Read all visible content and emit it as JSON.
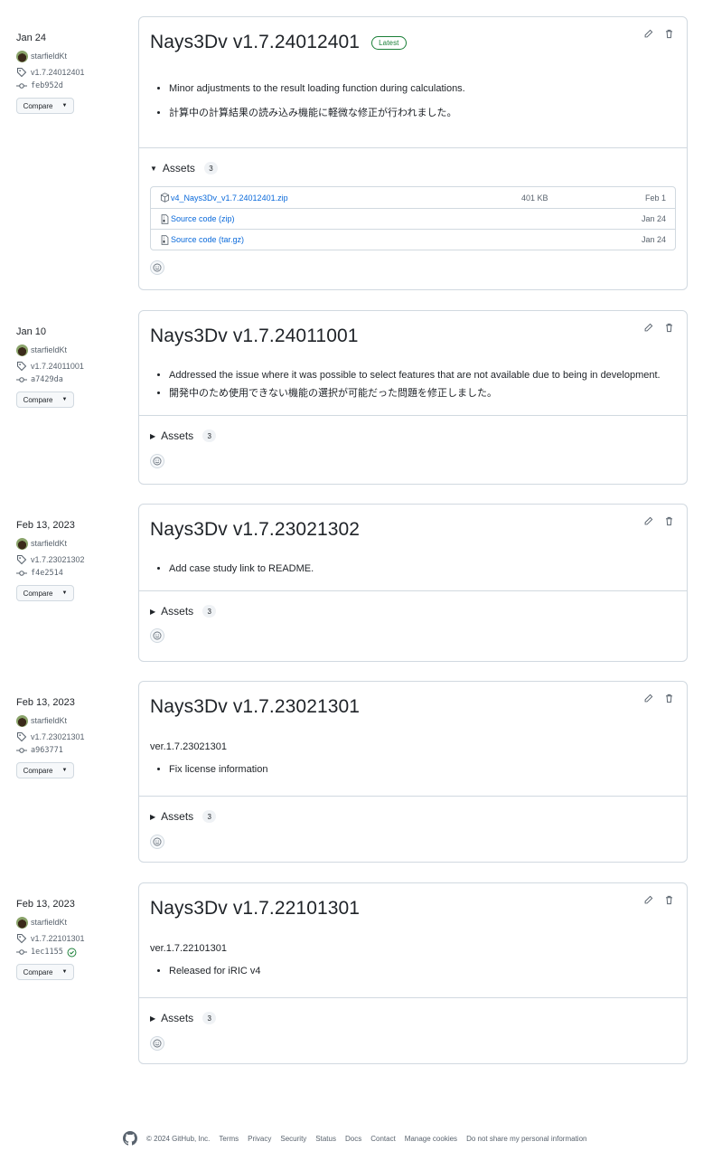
{
  "releases": [
    {
      "date": "Jan 24",
      "author": "starfieldKt",
      "tag": "v1.7.24012401",
      "commit": "feb952d",
      "compare_label": "Compare",
      "title": "Nays3Dv v1.7.24012401",
      "badge": "Latest",
      "notes": [
        "Minor adjustments to the result loading function during calculations.",
        "計算中の計算結果の読み込み機能に軽微な修正が行われました。"
      ],
      "assets_label": "Assets",
      "assets_count": "3",
      "assets_expanded": true,
      "assets": [
        {
          "name": "v4_Nays3Dv_v1.7.24012401.zip",
          "size": "401 KB",
          "date": "Feb 1",
          "icon": "package-icon"
        },
        {
          "name": "Source code (zip)",
          "size": "",
          "date": "Jan 24",
          "icon": "file-zip-icon"
        },
        {
          "name": "Source code (tar.gz)",
          "size": "",
          "date": "Jan 24",
          "icon": "file-zip-icon"
        }
      ]
    },
    {
      "date": "Jan 10",
      "author": "starfieldKt",
      "tag": "v1.7.24011001",
      "commit": "a7429da",
      "compare_label": "Compare",
      "title": "Nays3Dv v1.7.24011001",
      "notes": [
        "Addressed the issue where it was possible to select features that are not available due to being in development.",
        "開発中のため使用できない機能の選択が可能だった問題を修正しました。"
      ],
      "assets_label": "Assets",
      "assets_count": "3"
    },
    {
      "date": "Feb 13, 2023",
      "author": "starfieldKt",
      "tag": "v1.7.23021302",
      "commit": "f4e2514",
      "compare_label": "Compare",
      "title": "Nays3Dv v1.7.23021302",
      "notes": [
        "Add case study link to README."
      ],
      "assets_label": "Assets",
      "assets_count": "3"
    },
    {
      "date": "Feb 13, 2023",
      "author": "starfieldKt",
      "tag": "v1.7.23021301",
      "commit": "a963771",
      "compare_label": "Compare",
      "title": "Nays3Dv v1.7.23021301",
      "intro": "ver.1.7.23021301",
      "notes": [
        "Fix license information"
      ],
      "assets_label": "Assets",
      "assets_count": "3"
    },
    {
      "date": "Feb 13, 2023",
      "author": "starfieldKt",
      "tag": "v1.7.22101301",
      "commit": "1ec1155",
      "verified": true,
      "compare_label": "Compare",
      "title": "Nays3Dv v1.7.22101301",
      "intro": "ver.1.7.22101301",
      "notes": [
        "Released for iRIC v4"
      ],
      "assets_label": "Assets",
      "assets_count": "3"
    }
  ],
  "footer": {
    "copyright": "© 2024 GitHub, Inc.",
    "links": [
      "Terms",
      "Privacy",
      "Security",
      "Status",
      "Docs",
      "Contact",
      "Manage cookies",
      "Do not share my personal information"
    ]
  },
  "colors": {
    "link": "#0969da",
    "latest": "#1a7f37",
    "border": "#d1d9e0",
    "muted": "#59636e"
  }
}
